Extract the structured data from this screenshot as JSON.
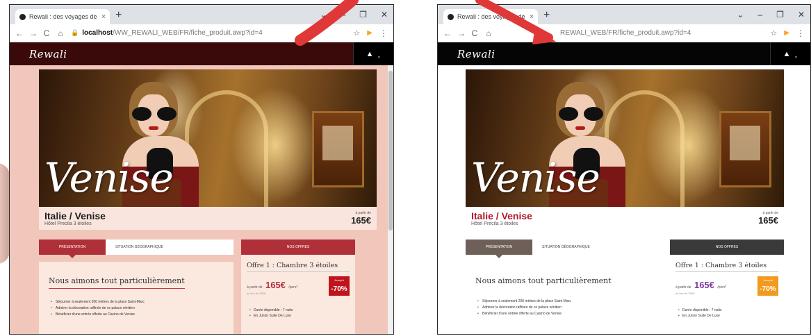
{
  "tab": {
    "title": "Rewali : des voyages de p",
    "close": "×",
    "new": "+"
  },
  "window_controls": {
    "minimize": "⌄",
    "restore": "–",
    "maximize": "❐",
    "close": "✕"
  },
  "nav": {
    "back": "←",
    "forward": "→",
    "reload": "C",
    "home": "⌂"
  },
  "address": {
    "host": "localhost",
    "path": "/WW_REWALI_WEB/FR/fiche_produit.awp?id=4",
    "path_short": "REWALI_WEB/FR/fiche_produit.awp?id=4"
  },
  "extensions": {
    "star": "☆",
    "play": "▶",
    "menu": "⋮"
  },
  "site": {
    "logo": "Rewali",
    "user_icon": "▲",
    "caret": "⌄"
  },
  "hero": {
    "word": "Venise"
  },
  "product": {
    "title": "Italie / Venise",
    "subtitle": "Hôtel Precila 3 étoiles",
    "price_from": "à partir de",
    "price": "165€"
  },
  "tabs": {
    "presentation": "PRÉSENTATION",
    "geo": "SITUATION GÉOGRAPHIQUE"
  },
  "description": {
    "title": "Nous aimons tout particulièrement",
    "items": [
      "Séjourner à seulement 200 mètres de la place Saint-Marc",
      "Admirer la décoration raffinée de ce palace vénitien",
      "Bénéficier d'une entrée offerte au Casino de Venise"
    ]
  },
  "offers": {
    "header": "NOS OFFRES",
    "title": "Offre 1 : Chambre 3 étoiles",
    "from": "à partir de",
    "price": "165€",
    "unit": "/pers*",
    "old": "au lieu de 550€",
    "badge_label": "Jusqu'à",
    "badge_pct": "-70%",
    "items": [
      "Durée disponible : 7 nuits",
      "En Junior Suite De Luxe"
    ]
  },
  "colors": {
    "accent_red": "#b0303a",
    "arrow_red": "#e03838"
  }
}
